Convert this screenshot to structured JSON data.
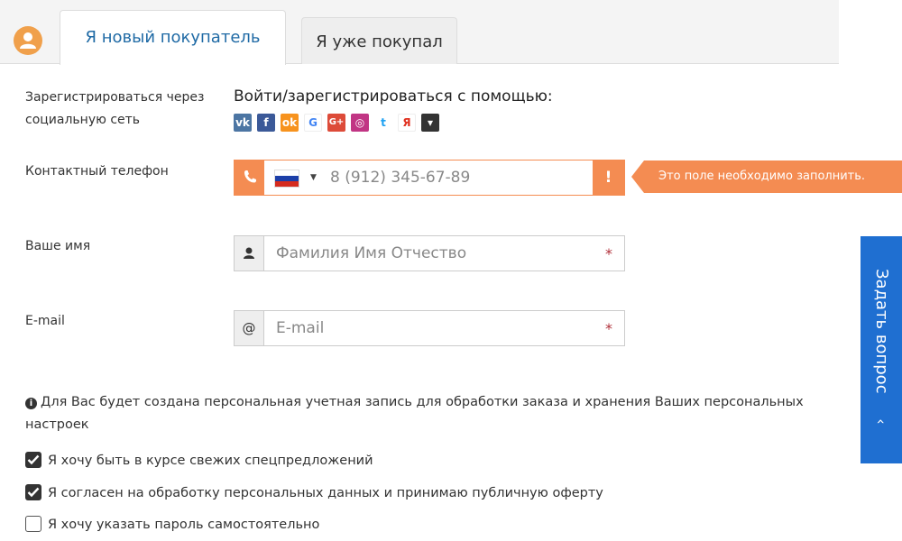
{
  "tabs": [
    {
      "label": "Я новый покупатель",
      "active": true
    },
    {
      "label": "Я уже покупал",
      "active": false
    }
  ],
  "social": {
    "label": "Зарегистрироваться через социальную сеть",
    "title": "Войти/зарегистрироваться с помощью:",
    "icons": [
      {
        "name": "vk-icon",
        "glyph": "vk",
        "color": "#4c75a3"
      },
      {
        "name": "facebook-icon",
        "glyph": "f",
        "color": "#3b5998"
      },
      {
        "name": "odnoklassniki-icon",
        "glyph": "ok",
        "color": "#f7931e"
      },
      {
        "name": "google-icon",
        "glyph": "G",
        "color": "#ffffff"
      },
      {
        "name": "google-plus-icon",
        "glyph": "G+",
        "color": "#dd4b39"
      },
      {
        "name": "instagram-icon",
        "glyph": "◎",
        "color": "#c13584"
      },
      {
        "name": "twitter-icon",
        "glyph": "t",
        "color": "#ffffff"
      },
      {
        "name": "yandex-icon",
        "glyph": "Я",
        "color": "#ffffff"
      },
      {
        "name": "more-dropdown-icon",
        "glyph": "▾",
        "color": "#333333"
      }
    ]
  },
  "phone": {
    "label": "Контактный телефон",
    "placeholder": "8 (912) 345-67-89",
    "warning": "!",
    "tooltip": "Это поле необходимо заполнить."
  },
  "name": {
    "label": "Ваше имя",
    "placeholder": "Фамилия Имя Отчество",
    "required_mark": "*"
  },
  "email": {
    "label": "E-mail",
    "addon": "@",
    "placeholder": "E-mail",
    "required_mark": "*"
  },
  "info": {
    "icon": "i",
    "text": "Для Вас будет создана персональная учетная запись для обработки заказа и хранения Ваших персональных настроек"
  },
  "checkboxes": [
    {
      "label": "Я хочу быть в курсе свежих спецпредложений",
      "checked": true
    },
    {
      "label": "Я согласен на обработку персональных данных и принимаю публичную оферту",
      "checked": true
    },
    {
      "label": "Я хочу указать пароль самостоятельно",
      "checked": false
    }
  ],
  "ask_button": {
    "label": "Задать вопрос",
    "chevron": "‹"
  },
  "colors": {
    "accent_orange": "#f48c52",
    "tab_blue": "#1f6aa5",
    "ask_blue": "#1f6fd1",
    "required_red": "#b0303a"
  }
}
